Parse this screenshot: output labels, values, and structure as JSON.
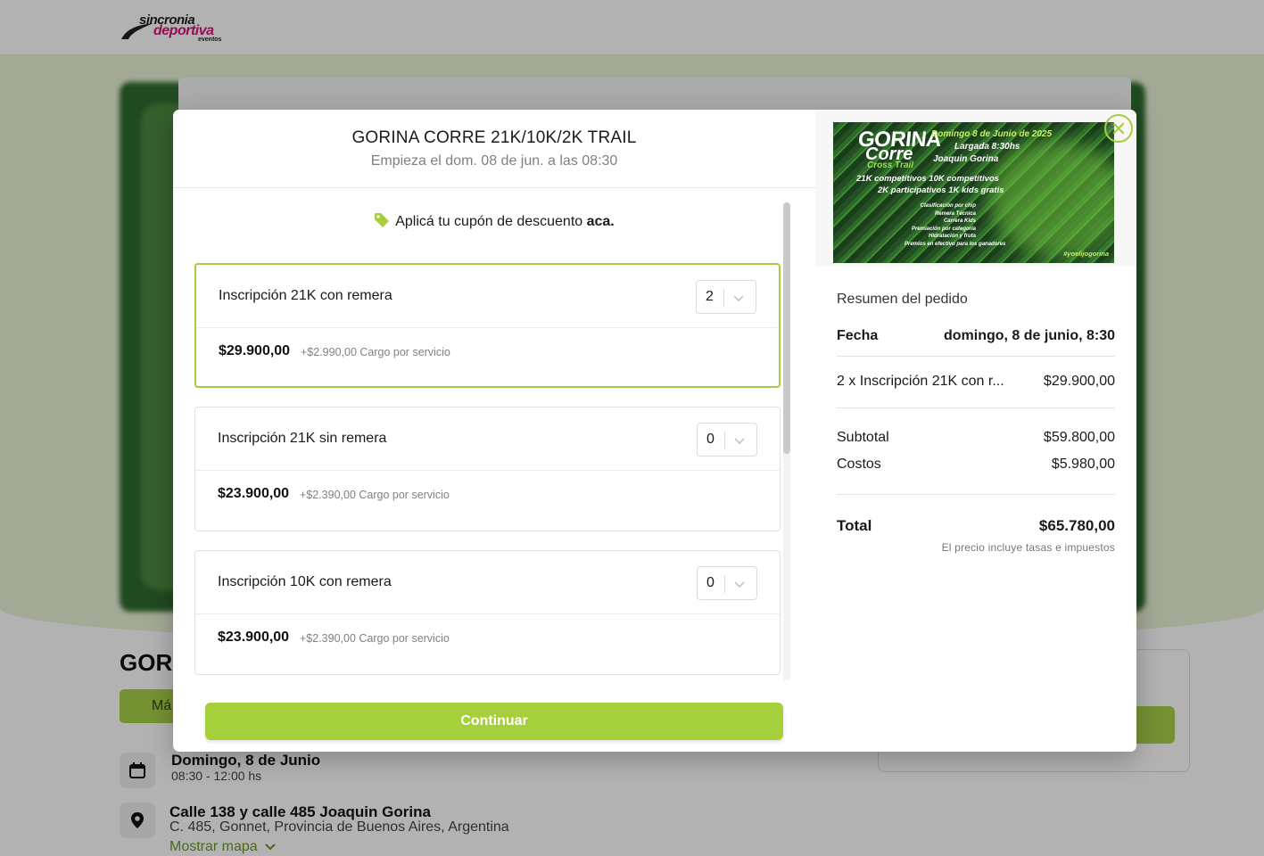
{
  "background": {
    "logo": {
      "line1": "sincronia",
      "line2": "deportiva",
      "line3": "eventos"
    },
    "event_title_partial": "GOR",
    "chip_label": "Má",
    "date": {
      "title": "Domingo, 8 de Junio",
      "time": "08:30 - 12:00 hs"
    },
    "location": {
      "title": "Calle 138 y calle 485 Joaquin Gorina",
      "address": "C. 485, Gonnet, Provincia de Buenos Aires, Argentina",
      "map_link": "Mostrar mapa"
    }
  },
  "modal": {
    "title": "GORINA CORRE 21K/10K/2K TRAIL",
    "subtitle": "Empieza el dom. 08 de jun. a las 08:30",
    "coupon": {
      "text": "Aplicá tu cupón de descuento ",
      "link": "aca."
    },
    "tickets": [
      {
        "name": "Inscripción 21K con remera",
        "qty": "2",
        "price": "$29.900,00",
        "fee": "+$2.990,00 Cargo por servicio"
      },
      {
        "name": "Inscripción 21K sin remera",
        "qty": "0",
        "price": "$23.900,00",
        "fee": "+$2.390,00 Cargo por servicio"
      },
      {
        "name": "Inscripción 10K con remera",
        "qty": "0",
        "price": "$23.900,00",
        "fee": "+$2.390,00 Cargo por servicio"
      }
    ],
    "continue_label": "Continuar"
  },
  "banner": {
    "brand1": "GORINA",
    "brand2": "Corre",
    "brand3": "Cross Trail",
    "date_line": "Domingo 8 de Junio de 2025",
    "start_line": "Largada 8:30hs",
    "place_line": "Joaquin Gorina",
    "line_a": "21K competitivos   10K competitivos",
    "line_b": "2K participativos   1K kids gratis",
    "features": [
      "Clasificación por chip",
      "Remera Técnica",
      "Carrera Kids",
      "Premiación por categoría",
      "Hidratación y fruta",
      "Premios en efectivo para los ganadores"
    ],
    "hashtag": "#yoelijogorina"
  },
  "summary": {
    "title": "Resumen del pedido",
    "date_label": "Fecha",
    "date_value": "domingo, 8 de junio, 8:30",
    "line_item_label": "2 x Inscripción 21K con r...",
    "line_item_value": "$29.900,00",
    "subtotal_label": "Subtotal",
    "subtotal_value": "$59.800,00",
    "costs_label": "Costos",
    "costs_value": "$5.980,00",
    "total_label": "Total",
    "total_value": "$65.780,00",
    "note": "El precio incluye tasas e impuestos"
  },
  "colors": {
    "accent": "#a6cf3c",
    "accent_border": "#a6cc40",
    "brand_pink": "#d4147a"
  }
}
